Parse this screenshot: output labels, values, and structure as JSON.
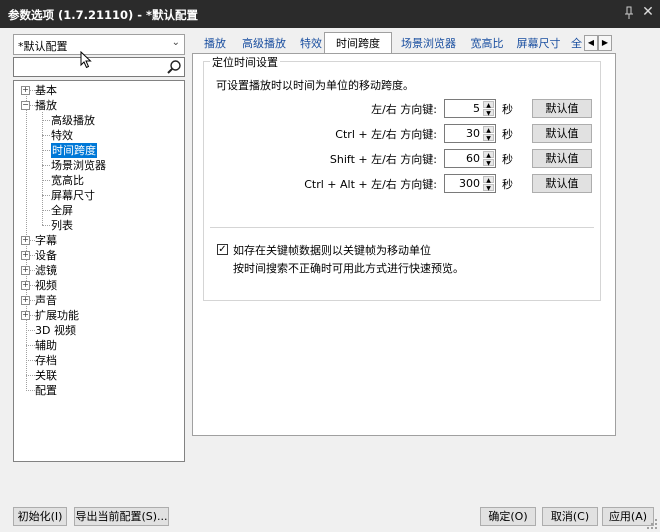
{
  "window": {
    "title": "参数选项 (1.7.21110) - *默认配置"
  },
  "left": {
    "profile_combo": "*默认配置",
    "search_placeholder": "",
    "tree": [
      {
        "label": "基本",
        "expanded": false
      },
      {
        "label": "播放",
        "expanded": true
      },
      {
        "label": "高级播放"
      },
      {
        "label": "特效"
      },
      {
        "label": "时间跨度",
        "selected": true
      },
      {
        "label": "场景浏览器"
      },
      {
        "label": "宽高比"
      },
      {
        "label": "屏幕尺寸"
      },
      {
        "label": "全屏"
      },
      {
        "label": "列表"
      },
      {
        "label": "字幕",
        "expanded": false
      },
      {
        "label": "设备",
        "expanded": false
      },
      {
        "label": "滤镜",
        "expanded": false
      },
      {
        "label": "视频",
        "expanded": false
      },
      {
        "label": "声音",
        "expanded": false
      },
      {
        "label": "扩展功能",
        "expanded": false
      },
      {
        "label": "3D 视频"
      },
      {
        "label": "辅助"
      },
      {
        "label": "存档"
      },
      {
        "label": "关联"
      },
      {
        "label": "配置"
      }
    ]
  },
  "tabs": [
    "播放",
    "高级播放",
    "特效",
    "时间跨度",
    "场景浏览器",
    "宽高比",
    "屏幕尺寸",
    "全"
  ],
  "active_tab": "时间跨度",
  "group": {
    "title": "定位时间设置",
    "description": "可设置播放时以时间为单位的移动跨度。",
    "rows": [
      {
        "label": "左/右 方向键:",
        "value": "5",
        "unit": "秒",
        "button": "默认值"
      },
      {
        "label": "Ctrl + 左/右 方向键:",
        "value": "30",
        "unit": "秒",
        "button": "默认值"
      },
      {
        "label": "Shift + 左/右 方向键:",
        "value": "60",
        "unit": "秒",
        "button": "默认值"
      },
      {
        "label": "Ctrl + Alt + 左/右 方向键:",
        "value": "300",
        "unit": "秒",
        "button": "默认值"
      }
    ],
    "checkbox_label": "如存在关键帧数据则以关键帧为移动单位",
    "checkbox_checked": true,
    "checkbox_note": "按时间搜索不正确时可用此方式进行快速预览。"
  },
  "footer": {
    "init_button": "初始化(I)",
    "export_button": "导出当前配置(S)...",
    "ok_button": "确定(O)",
    "cancel_button": "取消(C)",
    "apply_button": "应用(A)"
  }
}
